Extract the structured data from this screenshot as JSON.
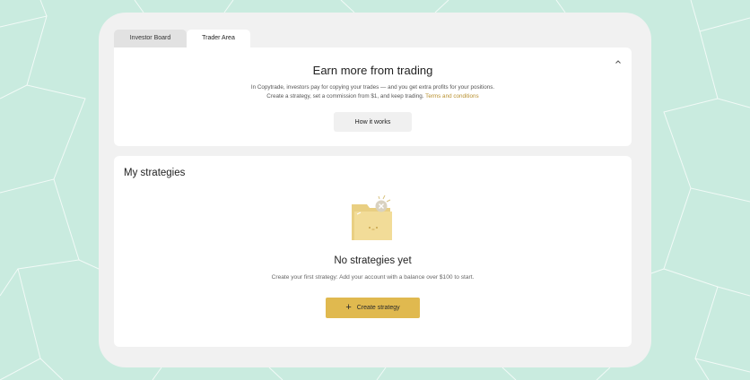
{
  "tabs": [
    {
      "label": "Investor Board",
      "active": false
    },
    {
      "label": "Trader Area",
      "active": true
    }
  ],
  "promo": {
    "title": "Earn more from trading",
    "line1": "In Copytrade, investors pay for copying your trades — and you get extra profits for your positions.",
    "line2": "Create a strategy, set a commission from $1, and keep trading.",
    "terms_link": "Terms and conditions",
    "how_button": "How it works",
    "collapse_icon": "chevron-up-icon"
  },
  "strategies": {
    "title": "My strategies",
    "empty_icon": "empty-folder-icon",
    "empty_title": "No strategies yet",
    "empty_subtitle": "Create your first strategy: Add your account with a balance over $100 to start.",
    "create_button": "Create strategy",
    "create_icon": "plus-icon"
  },
  "colors": {
    "background": "#c9ebdf",
    "accent": "#e0b94f",
    "link": "#b8902f"
  }
}
